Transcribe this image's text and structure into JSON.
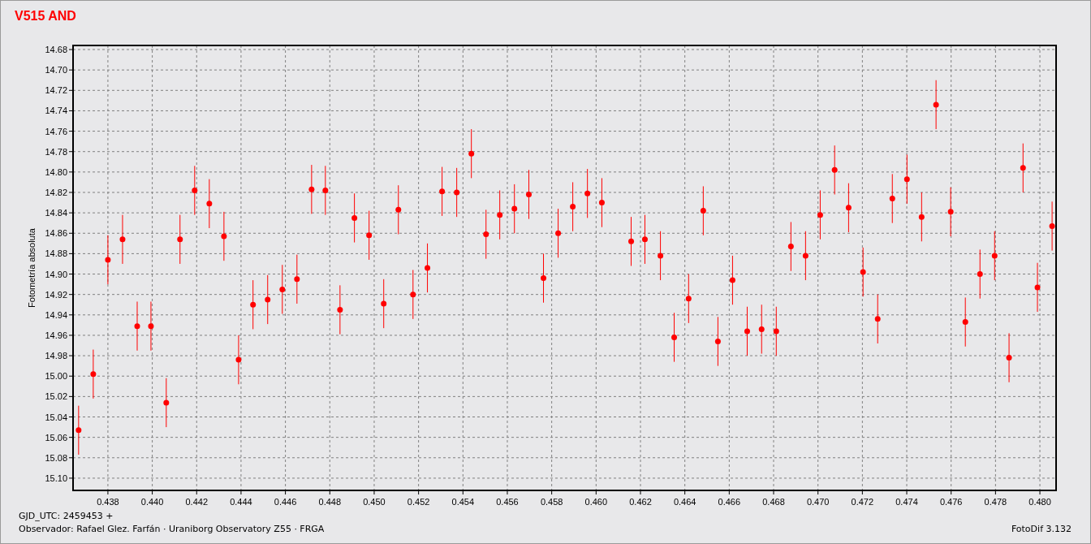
{
  "title": "V515 AND",
  "chart": {
    "chart_data": {
      "type": "scatter",
      "grid": true,
      "ylabel": "Fotometría absoluta",
      "xlim": [
        0.43643,
        0.48073
      ],
      "ylim": [
        15.112,
        14.676
      ],
      "xticks": [
        {
          "value": 0.438,
          "label": "0.438"
        },
        {
          "value": 0.44,
          "label": "0.440"
        },
        {
          "value": 0.442,
          "label": "0.442"
        },
        {
          "value": 0.444,
          "label": "0.444"
        },
        {
          "value": 0.446,
          "label": "0.446"
        },
        {
          "value": 0.448,
          "label": "0.448"
        },
        {
          "value": 0.45,
          "label": "0.450"
        },
        {
          "value": 0.452,
          "label": "0.452"
        },
        {
          "value": 0.454,
          "label": "0.454"
        },
        {
          "value": 0.456,
          "label": "0.456"
        },
        {
          "value": 0.458,
          "label": "0.458"
        },
        {
          "value": 0.46,
          "label": "0.460"
        },
        {
          "value": 0.462,
          "label": "0.462"
        },
        {
          "value": 0.464,
          "label": "0.464"
        },
        {
          "value": 0.466,
          "label": "0.466"
        },
        {
          "value": 0.468,
          "label": "0.468"
        },
        {
          "value": 0.47,
          "label": "0.470"
        },
        {
          "value": 0.472,
          "label": "0.472"
        },
        {
          "value": 0.474,
          "label": "0.474"
        },
        {
          "value": 0.476,
          "label": "0.476"
        },
        {
          "value": 0.478,
          "label": "0.478"
        },
        {
          "value": 0.48,
          "label": "0.480"
        }
      ],
      "yticks": [
        {
          "value": 14.68,
          "label": "14.68"
        },
        {
          "value": 14.7,
          "label": "14.70"
        },
        {
          "value": 14.72,
          "label": "14.72"
        },
        {
          "value": 14.74,
          "label": "14.74"
        },
        {
          "value": 14.76,
          "label": "14.76"
        },
        {
          "value": 14.78,
          "label": "14.78"
        },
        {
          "value": 14.8,
          "label": "14.80"
        },
        {
          "value": 14.82,
          "label": "14.82"
        },
        {
          "value": 14.84,
          "label": "14.84"
        },
        {
          "value": 14.86,
          "label": "14.86"
        },
        {
          "value": 14.88,
          "label": "14.88"
        },
        {
          "value": 14.9,
          "label": "14.90"
        },
        {
          "value": 14.92,
          "label": "14.92"
        },
        {
          "value": 14.94,
          "label": "14.94"
        },
        {
          "value": 14.96,
          "label": "14.96"
        },
        {
          "value": 14.98,
          "label": "14.98"
        },
        {
          "value": 15.0,
          "label": "15.00"
        },
        {
          "value": 15.02,
          "label": "15.02"
        },
        {
          "value": 15.04,
          "label": "15.04"
        },
        {
          "value": 15.06,
          "label": "15.06"
        },
        {
          "value": 15.08,
          "label": "15.08"
        },
        {
          "value": 15.1,
          "label": "15.10"
        }
      ],
      "x": [
        0.43668,
        0.43734,
        0.438,
        0.43866,
        0.43932,
        0.43994,
        0.44063,
        0.44125,
        0.44191,
        0.44257,
        0.44323,
        0.44389,
        0.44454,
        0.4452,
        0.44586,
        0.44652,
        0.44718,
        0.4478,
        0.44846,
        0.44911,
        0.44977,
        0.45043,
        0.45109,
        0.45175,
        0.4524,
        0.45306,
        0.45372,
        0.45438,
        0.45504,
        0.45566,
        0.45632,
        0.45697,
        0.45763,
        0.45829,
        0.45895,
        0.45961,
        0.46026,
        0.46158,
        0.4622,
        0.4629,
        0.46352,
        0.46417,
        0.46483,
        0.46549,
        0.46615,
        0.46681,
        0.46746,
        0.46812,
        0.46878,
        0.46944,
        0.4701,
        0.47075,
        0.47138,
        0.47203,
        0.47269,
        0.47335,
        0.47401,
        0.47467,
        0.47532,
        0.47598,
        0.47664,
        0.4773,
        0.47796,
        0.47861,
        0.47924,
        0.47989,
        0.48055
      ],
      "series": [
        {
          "color": "#ff0000",
          "errors": [
            0.024,
            0.024,
            0.024,
            0.024,
            0.024,
            0.024,
            0.024,
            0.024,
            0.024,
            0.024,
            0.024,
            0.024,
            0.024,
            0.024,
            0.024,
            0.024,
            0.024,
            0.024,
            0.024,
            0.024,
            0.024,
            0.024,
            0.024,
            0.024,
            0.024,
            0.024,
            0.024,
            0.024,
            0.024,
            0.024,
            0.024,
            0.024,
            0.024,
            0.024,
            0.024,
            0.024,
            0.024,
            0.024,
            0.024,
            0.024,
            0.024,
            0.024,
            0.024,
            0.024,
            0.024,
            0.024,
            0.024,
            0.024,
            0.024,
            0.024,
            0.024,
            0.024,
            0.024,
            0.024,
            0.024,
            0.024,
            0.024,
            0.024,
            0.024,
            0.024,
            0.024,
            0.024,
            0.024,
            0.024,
            0.024,
            0.024,
            0.024
          ],
          "values": [
            15.053,
            14.998,
            14.886,
            14.866,
            14.951,
            14.951,
            15.026,
            14.866,
            14.818,
            14.831,
            14.863,
            14.984,
            14.93,
            14.925,
            14.915,
            14.905,
            14.817,
            14.818,
            14.935,
            14.845,
            14.862,
            14.929,
            14.837,
            14.92,
            14.894,
            14.819,
            14.82,
            14.782,
            14.861,
            14.842,
            14.836,
            14.822,
            14.904,
            14.86,
            14.834,
            14.821,
            14.83,
            14.868,
            14.866,
            14.882,
            14.962,
            14.924,
            14.838,
            14.966,
            14.906,
            14.956,
            14.954,
            14.956,
            14.873,
            14.882,
            14.842,
            14.798,
            14.835,
            14.898,
            14.944,
            14.826,
            14.807,
            14.844,
            14.734,
            14.839,
            14.947,
            14.9,
            14.882,
            14.982,
            14.796,
            14.913,
            14.853
          ]
        }
      ]
    }
  },
  "footer": {
    "date_line": "GJD_UTC: 2459453 +",
    "observer_line": "Observador: Rafael Glez. Farfán · Uraniborg Observatory Z55 · FRGA",
    "version": "FotoDif 3.132"
  }
}
